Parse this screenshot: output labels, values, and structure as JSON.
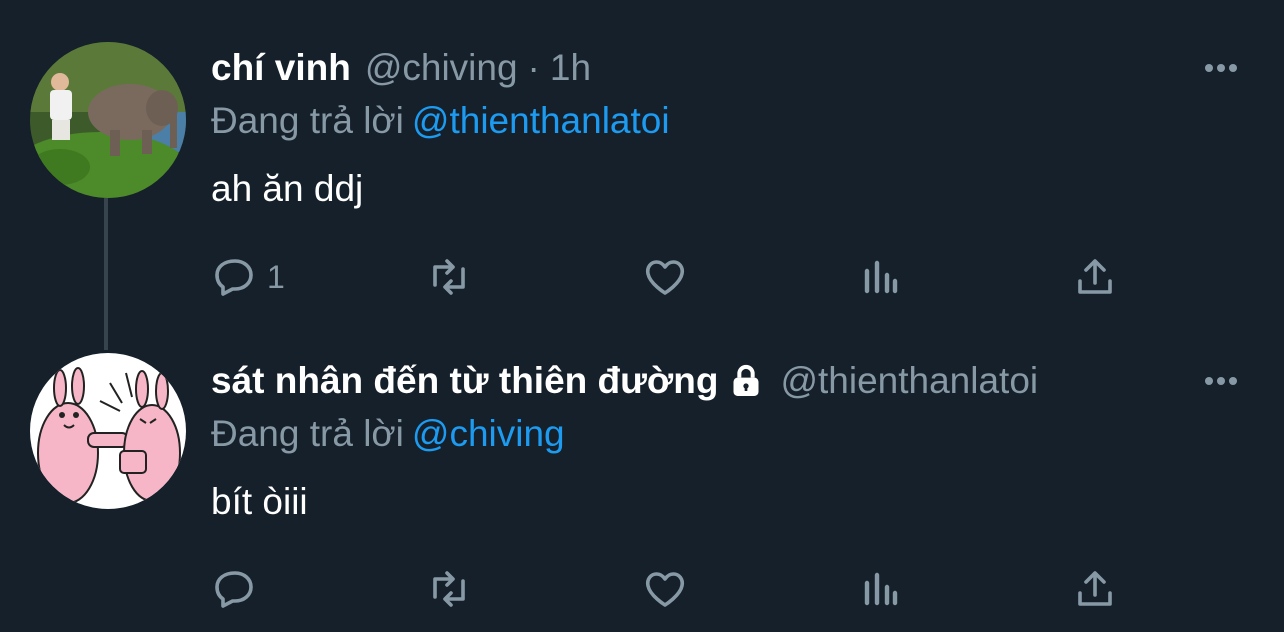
{
  "colors": {
    "background": "#15202b",
    "secondary_text": "#8899a6",
    "mention": "#1d9bf0",
    "thread_line": "#38444d"
  },
  "tweets": [
    {
      "display_name": "chí vinh",
      "handle": "@chiving",
      "separator": "·",
      "time": "1h",
      "reply_prefix": "Đang trả lời",
      "reply_to": "@thienthanlatoi",
      "text": "ah ăn ddj",
      "reply_count": "1",
      "locked": false,
      "avatar_icon": "elephant-photo-avatar",
      "actions": [
        "reply-icon",
        "retweet-icon",
        "like-icon",
        "analytics-icon",
        "share-icon"
      ]
    },
    {
      "display_name": "sát nhân đến từ thiên đường",
      "handle": "@thienthanlatoi",
      "reply_prefix": "Đang trả lời",
      "reply_to": "@chiving",
      "text": "bít òiii",
      "reply_count": "",
      "locked": true,
      "avatar_icon": "bunny-cartoon-avatar",
      "actions": [
        "reply-icon",
        "retweet-icon",
        "like-icon",
        "analytics-icon",
        "share-icon"
      ]
    }
  ]
}
